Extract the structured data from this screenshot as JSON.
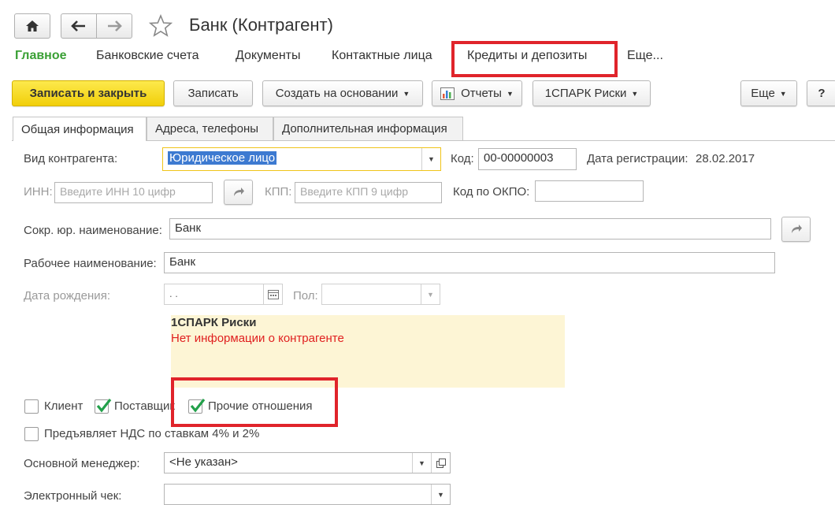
{
  "window": {
    "title": "Банк (Контрагент)"
  },
  "nav_menu": {
    "items": [
      "Главное",
      "Банковские счета",
      "Документы",
      "Контактные лица",
      "Кредиты и депозиты",
      "Еще..."
    ]
  },
  "toolbar": {
    "save_close": "Записать и закрыть",
    "save": "Записать",
    "create_based": "Создать на основании",
    "reports": "Отчеты",
    "spark": "1СПАРК Риски",
    "more": "Еще",
    "help": "?"
  },
  "tabs": [
    "Общая информация",
    "Адреса, телефоны",
    "Дополнительная информация"
  ],
  "form": {
    "kind_label": "Вид контрагента:",
    "kind_value": "Юридическое лицо",
    "code_label": "Код:",
    "code_value": "00-00000003",
    "reg_date_label": "Дата регистрации:",
    "reg_date_value": "28.02.2017",
    "inn_label": "ИНН:",
    "inn_placeholder": "Введите ИНН 10 цифр",
    "kpp_label": "КПП:",
    "kpp_placeholder": "Введите КПП 9 цифр",
    "okpo_label": "Код по ОКПО:",
    "okpo_value": "",
    "short_name_label": "Сокр. юр. наименование:",
    "short_name_value": "Банк",
    "work_name_label": "Рабочее наименование:",
    "work_name_value": "Банк",
    "birth_label": "Дата рождения:",
    "birth_value": ". .",
    "sex_label": "Пол:",
    "sex_value": ""
  },
  "spark_panel": {
    "title": "1СПАРК Риски",
    "message": "Нет информации о контрагенте"
  },
  "checkboxes": {
    "client": {
      "label": "Клиент",
      "checked": false
    },
    "supplier": {
      "label": "Поставщик",
      "checked": true
    },
    "other": {
      "label": "Прочие отношения",
      "checked": true
    },
    "vat": {
      "label": "Предъявляет НДС по ставкам 4% и 2%",
      "checked": false
    }
  },
  "manager": {
    "label": "Основной менеджер:",
    "value": "<Не указан>"
  },
  "receipt": {
    "label": "Электронный чек:",
    "value": ""
  },
  "colors": {
    "accent_green": "#3aa035",
    "highlight_red": "#e0242b",
    "primary_yellow": "#f5d81c",
    "selection_blue": "#3d7ad1",
    "spark_bg": "#fdf5d5",
    "spark_error": "#e02020"
  }
}
